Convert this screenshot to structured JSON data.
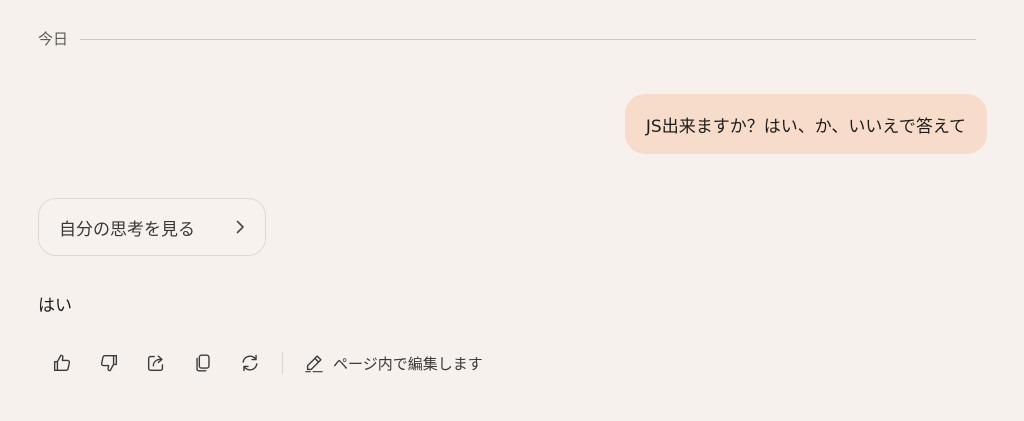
{
  "conversation": {
    "date_label": "今日",
    "user_message": "JS出来ますか？はい、か、いいえで答えて",
    "thinking_toggle_label": "自分の思考を見る",
    "assistant_reply": "はい"
  },
  "toolbar": {
    "buttons": [
      {
        "name": "thumbs-up-icon"
      },
      {
        "name": "thumbs-down-icon"
      },
      {
        "name": "share-icon"
      },
      {
        "name": "copy-icon"
      },
      {
        "name": "retry-icon"
      }
    ],
    "edit_label": "ページ内で編集します"
  },
  "colors": {
    "background": "#f7f1ee",
    "user_bubble": "#f8dccb",
    "divider": "#d7c6b8",
    "pill_border": "#e1d7d1"
  }
}
